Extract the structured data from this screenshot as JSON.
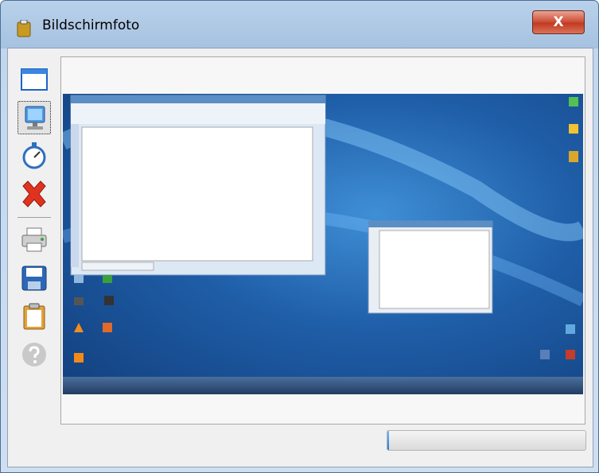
{
  "window": {
    "title": "Bildschirmfoto",
    "close_label": "X",
    "icons": {
      "app": "clipboard-app-icon",
      "close": "close-icon"
    }
  },
  "toolbar": {
    "tools": [
      {
        "id": "window",
        "icon": "window-capture-icon"
      },
      {
        "id": "desktop",
        "icon": "monitor-icon",
        "selected": true
      },
      {
        "id": "timer",
        "icon": "stopwatch-icon"
      },
      {
        "id": "cancel",
        "icon": "red-x-icon"
      },
      {
        "id": "print",
        "icon": "printer-icon"
      },
      {
        "id": "save",
        "icon": "floppy-disk-icon"
      },
      {
        "id": "clipboard",
        "icon": "clipboard-icon"
      },
      {
        "id": "help",
        "icon": "help-icon",
        "disabled": true
      }
    ]
  },
  "preview": {
    "content": "desktop-screenshot-thumbnail"
  },
  "progress": {
    "fraction": 0.01
  },
  "colors": {
    "accent": "#1f7bd8",
    "close": "#c23a22",
    "desktop": "#1f5ea8"
  }
}
